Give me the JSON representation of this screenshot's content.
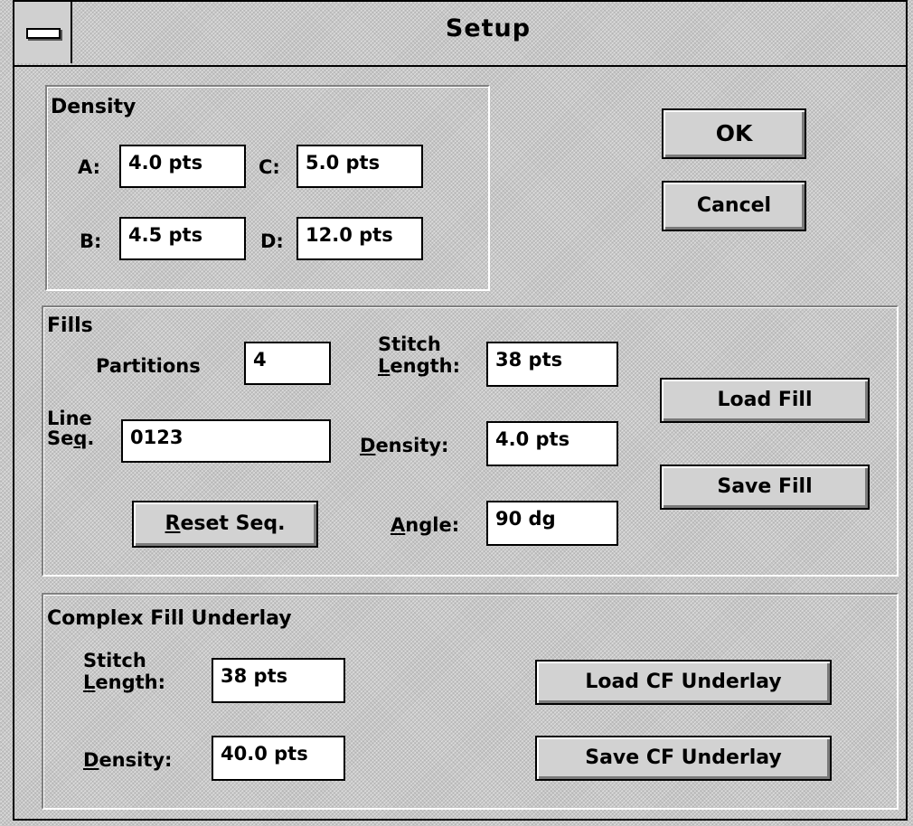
{
  "window": {
    "title": "Setup"
  },
  "density": {
    "group_label": "Density",
    "a_label": "A:",
    "a_value": "4.0 pts",
    "b_label": "B:",
    "b_value": "4.5 pts",
    "c_label": "C:",
    "c_value": "5.0 pts",
    "d_label": "D:",
    "d_value": "12.0 pts"
  },
  "buttons": {
    "ok": "OK",
    "cancel": "Cancel"
  },
  "fills": {
    "group_label": "Fills",
    "partitions_label": "Partitions",
    "partitions_value": "4",
    "line_seq_label_1": "Line",
    "line_seq_label_2": "Seq.",
    "line_seq_value": "0123",
    "reset_seq": "Reset Seq.",
    "stitch_label_1": "Stitch",
    "stitch_label_2": "Length:",
    "stitch_value": "38 pts",
    "density_label": "Density:",
    "density_value": "4.0 pts",
    "angle_label": "Angle:",
    "angle_value": "90 dg",
    "load_fill": "Load Fill",
    "save_fill": "Save Fill"
  },
  "underlay": {
    "group_label": "Complex Fill Underlay",
    "stitch_label_1": "Stitch",
    "stitch_label_2": "Length:",
    "stitch_value": "38 pts",
    "density_label": "Density:",
    "density_value": "40.0 pts",
    "load_cf": "Load CF Underlay",
    "save_cf": "Save CF Underlay"
  },
  "colors": {
    "face": "#c6c6c6",
    "field": "#ffffff",
    "text": "#000000"
  },
  "icons": {
    "system_menu": "system-menu-icon"
  }
}
